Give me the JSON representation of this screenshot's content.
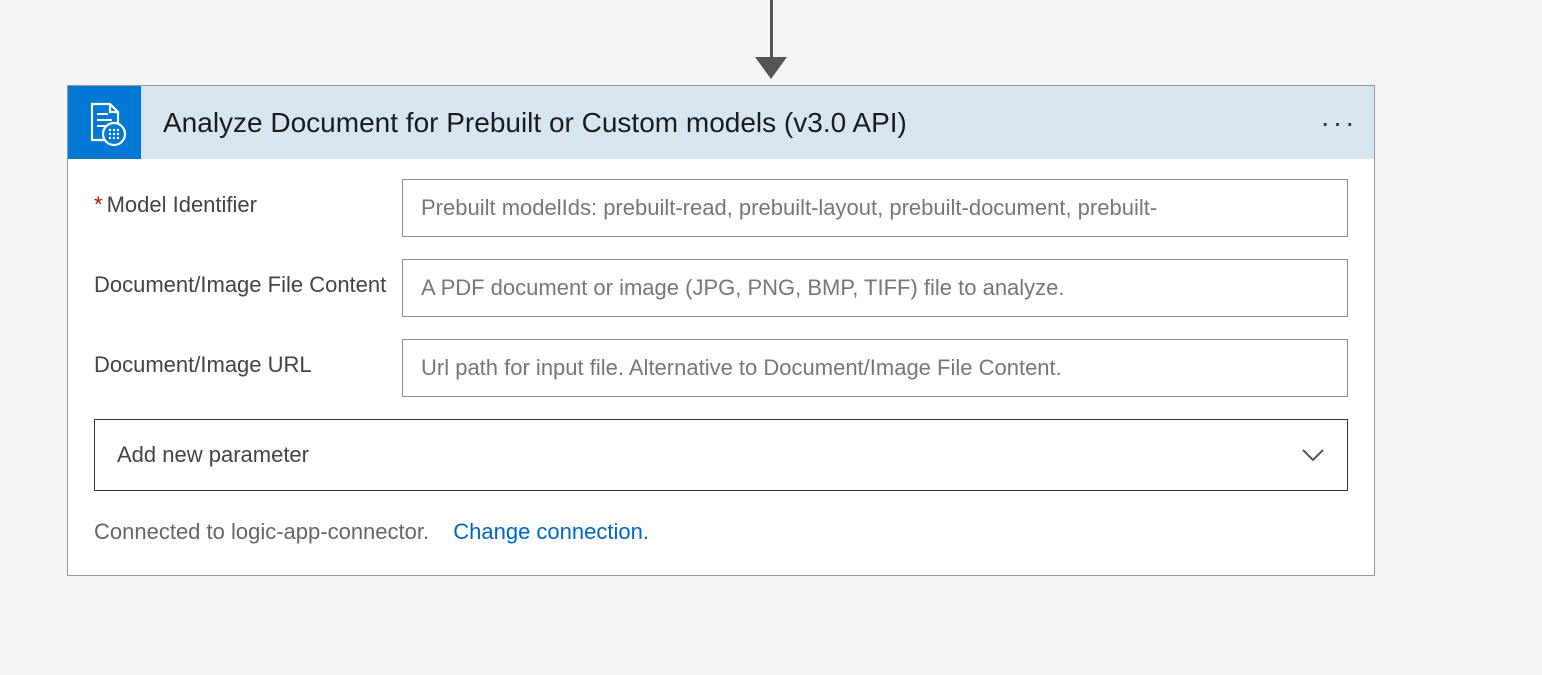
{
  "card": {
    "title": "Analyze Document for Prebuilt or Custom models (v3.0 API)",
    "fields": [
      {
        "label": "Model Identifier",
        "required": true,
        "placeholder": "Prebuilt modelIds: prebuilt-read, prebuilt-layout, prebuilt-document, prebuilt-"
      },
      {
        "label": "Document/Image File Content",
        "required": false,
        "placeholder": "A PDF document or image (JPG, PNG, BMP, TIFF) file to analyze."
      },
      {
        "label": "Document/Image URL",
        "required": false,
        "placeholder": "Url path for input file. Alternative to Document/Image File Content."
      }
    ],
    "dropdown_label": "Add new parameter",
    "footer_text": "Connected to logic-app-connector.",
    "change_link": "Change connection."
  }
}
